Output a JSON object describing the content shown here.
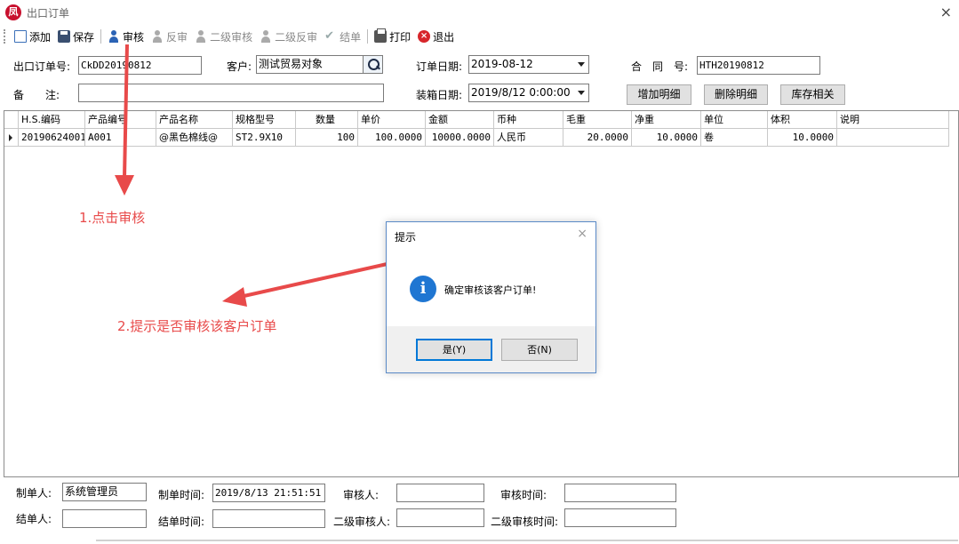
{
  "window": {
    "icon_text": "凤",
    "title": "出口订单",
    "close": "×"
  },
  "toolbar": {
    "add": "添加",
    "save": "保存",
    "audit": "审核",
    "unaudit": "反审",
    "audit2": "二级审核",
    "unaudit2": "二级反审",
    "close_order": "结单",
    "print": "打印",
    "exit": "退出"
  },
  "form": {
    "order_no_label": "出口订单号:",
    "order_no": "CkDD20190812",
    "customer_label": "客户:",
    "customer": "测试贸易对象",
    "order_date_label": "订单日期:",
    "order_date": "2019-08-12",
    "contract_label": "合　同　号:",
    "contract_no": "HTH20190812",
    "remark_label": "备　　注:",
    "remark": "",
    "load_date_label": "装箱日期:",
    "load_date": "2019/8/12 0:00:00",
    "add_detail": "增加明细",
    "delete_detail": "删除明细",
    "stock": "库存相关"
  },
  "grid": {
    "headers": [
      "H.S.编码",
      "产品编号",
      "产品名称",
      "规格型号",
      "数量",
      "单价",
      "金额",
      "币种",
      "毛重",
      "净重",
      "单位",
      "体积",
      "说明"
    ],
    "rows": [
      [
        "20190624001",
        "A001",
        "@黑色棉线@",
        "ST2.9X10",
        "100",
        "100.0000",
        "10000.0000",
        "人民币",
        "20.0000",
        "10.0000",
        "卷",
        "10.0000",
        ""
      ]
    ]
  },
  "annotations": {
    "step1": "1.点击审核",
    "step2": "2.提示是否审核该客户订单"
  },
  "dialog": {
    "title": "提示",
    "close": "×",
    "icon": "i",
    "message": "确定审核该客户订单!",
    "yes": "是(Y)",
    "no": "否(N)"
  },
  "footer": {
    "maker_label": "制单人:",
    "maker": "系统管理员",
    "make_time_label": "制单时间:",
    "make_time": "2019/8/13 21:51:51",
    "auditor_label": "审核人:",
    "auditor": "",
    "audit_time_label": "审核时间:",
    "audit_time": "",
    "closer_label": "结单人:",
    "closer": "",
    "close_time_label": "结单时间:",
    "close_time": "",
    "auditor2_label": "二级审核人:",
    "auditor2": "",
    "audit2_time_label": "二级审核时间:",
    "audit2_time": ""
  },
  "colors": {
    "annotation": "#e84a4a",
    "dialog_border": "#5a8ac7",
    "info_icon": "#1f76d2"
  }
}
